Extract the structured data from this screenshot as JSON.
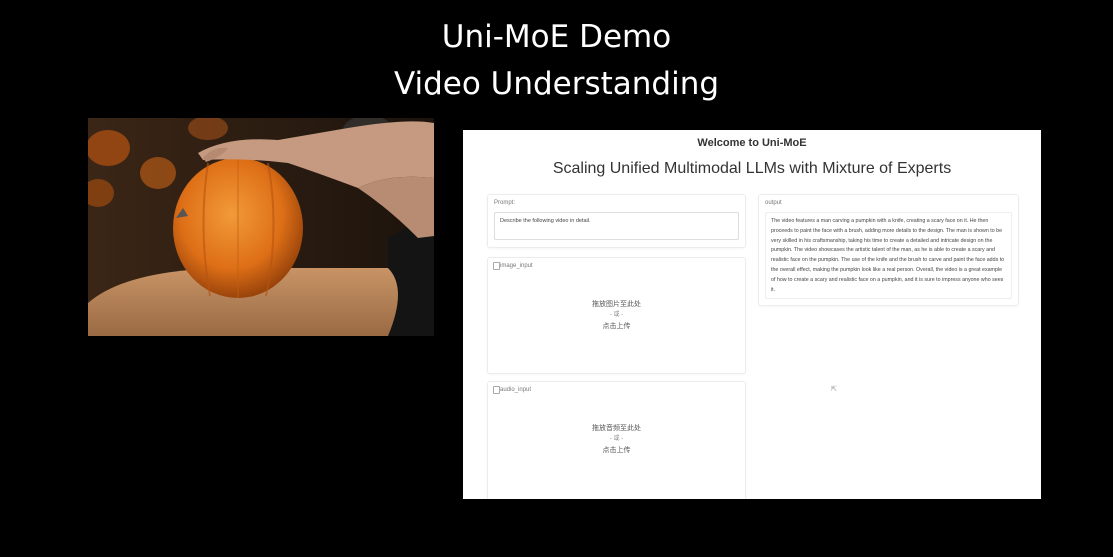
{
  "slide": {
    "title_line1": "Uni-MoE Demo",
    "title_line2": "Video Understanding"
  },
  "app": {
    "welcome": "Welcome to Uni-MoE",
    "heading": "Scaling Unified Multimodal LLMs with Mixture of Experts",
    "prompt": {
      "label": "Prompt:",
      "value": "Describe the following video in detail."
    },
    "image_input": {
      "label": "image_input",
      "drop_line1": "拖放图片至此处",
      "drop_line2": "- 或 -",
      "drop_line3": "点击上传"
    },
    "audio_input": {
      "label": "audio_input",
      "drop_line1": "拖放音频至此处",
      "drop_line2": "- 或 -",
      "drop_line3": "点击上传"
    },
    "output": {
      "label": "output",
      "value": "The video features a man carving a pumpkin with a knife, creating a scary face on it. He then proceeds to paint the face with a brush, adding more details to the design. The man is shown to be very skilled in his craftsmanship, taking his time to create a detailed and intricate design on the pumpkin. The video showcases the artistic talent of the man, as he is able to create a scary and realistic face on the pumpkin. The use of the knife and the brush to carve and paint the face adds to the overall effect, making the pumpkin look like a real person. Overall, the video is a great example of how to create a scary and realistic face on a pumpkin, and it is sure to impress anyone who sees it."
    }
  },
  "colors": {
    "background": "#000000",
    "pumpkin": "#e07a1f",
    "table": "#b9835a"
  }
}
